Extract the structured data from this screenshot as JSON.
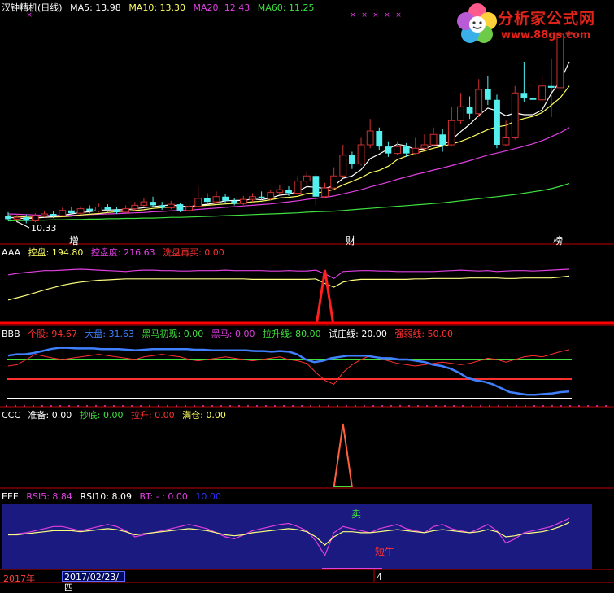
{
  "colors": {
    "bg": "#000000",
    "up": "#d03030",
    "down": "#54f0f0",
    "ma5": "#ffffff",
    "ma10": "#ffff60",
    "ma20": "#e040e0",
    "ma60": "#40e040",
    "aaa_line1": "#e040e0",
    "aaa_line2": "#ffff80",
    "bbb_blue": "#4080ff",
    "bbb_red": "#ff3030",
    "bbb_green": "#40e040",
    "panel_blue": "#1a1a80",
    "separator": "#c00000"
  },
  "header": {
    "name": "汉钟精机(日线)",
    "ma5": "MA5: 13.98",
    "ma10": "MA10: 13.30",
    "ma20": "MA20: 12.43",
    "ma60": "MA60: 11.25"
  },
  "main_annotations": {
    "low_label": "10.33",
    "tag_zeng": "增",
    "tag_cai": "财",
    "tag_bang": "榜",
    "x_marks": [
      "×",
      "×",
      "×",
      "×",
      "×",
      "×"
    ]
  },
  "aaa": {
    "name": "AAA",
    "kongpan": "控盘: 194.80",
    "kongpandu": "控盘度: 216.63",
    "xipan": "洗盘再买: 0.00"
  },
  "bbb": {
    "name": "BBB",
    "gegu": "个股: 94.67",
    "dapan": "大盘: 31.63",
    "heima_chu": "黑马初现: 0.00",
    "heima": "黑马: 0.00",
    "lasheng": "拉升线: 80.00",
    "shizhuang": "试庄线: 20.00",
    "qiangruo": "强弱线: 50.00"
  },
  "ccc": {
    "name": "CCC",
    "zhunbei": "准备: 0.00",
    "chaodi": "抄底: 0.00",
    "lasheng": "拉升: 0.00",
    "mancang": "满仓: 0.00"
  },
  "eee": {
    "name": "EEE",
    "rsi5": "RSI5: 8.84",
    "rsi10": "RSI10: 8.09",
    "bt": "BT: - : 0.00",
    "extra": "10.00",
    "sell": "卖",
    "short_bull": "短牛"
  },
  "footer": {
    "year": "2017年",
    "date": "2017/02/23/四",
    "num": "4"
  },
  "logo": {
    "title": "分析家公式网",
    "url": "www.88gs.com"
  },
  "chart_data": {
    "type": "candlestick",
    "title": "汉钟精机(日线)",
    "candles": [
      [
        10.55,
        10.45,
        10.65,
        10.4
      ],
      [
        10.45,
        10.5,
        10.6,
        10.35
      ],
      [
        10.5,
        10.4,
        10.58,
        10.33
      ],
      [
        10.4,
        10.55,
        10.62,
        10.36
      ],
      [
        10.55,
        10.6,
        10.7,
        10.5
      ],
      [
        10.6,
        10.55,
        10.68,
        10.48
      ],
      [
        10.55,
        10.7,
        10.78,
        10.52
      ],
      [
        10.7,
        10.62,
        10.8,
        10.58
      ],
      [
        10.62,
        10.75,
        10.82,
        10.58
      ],
      [
        10.75,
        10.68,
        10.85,
        10.62
      ],
      [
        10.68,
        10.8,
        10.9,
        10.64
      ],
      [
        10.8,
        10.72,
        10.88,
        10.66
      ],
      [
        10.72,
        10.65,
        10.8,
        10.6
      ],
      [
        10.65,
        10.75,
        10.85,
        10.6
      ],
      [
        10.75,
        10.85,
        10.95,
        10.7
      ],
      [
        10.85,
        10.95,
        11.05,
        10.8
      ],
      [
        10.95,
        10.85,
        11.1,
        10.8
      ],
      [
        10.85,
        10.78,
        10.95,
        10.72
      ],
      [
        10.78,
        10.88,
        10.98,
        10.74
      ],
      [
        10.88,
        10.7,
        10.92,
        10.65
      ],
      [
        10.7,
        10.82,
        10.9,
        10.66
      ],
      [
        10.82,
        11.05,
        11.4,
        10.8
      ],
      [
        11.05,
        10.95,
        11.2,
        10.9
      ],
      [
        10.95,
        11.1,
        11.25,
        10.9
      ],
      [
        11.1,
        10.98,
        11.18,
        10.9
      ],
      [
        10.98,
        10.9,
        11.05,
        10.85
      ],
      [
        10.9,
        11.02,
        11.12,
        10.86
      ],
      [
        11.02,
        11.1,
        11.2,
        10.95
      ],
      [
        11.1,
        11.05,
        11.25,
        11.0
      ],
      [
        11.05,
        11.22,
        11.3,
        11.0
      ],
      [
        11.22,
        11.3,
        11.45,
        11.15
      ],
      [
        11.3,
        11.2,
        11.4,
        11.12
      ],
      [
        11.2,
        11.55,
        11.7,
        11.15
      ],
      [
        11.55,
        11.7,
        11.85,
        11.45
      ],
      [
        11.7,
        11.1,
        11.75,
        10.85
      ],
      [
        11.1,
        11.35,
        11.5,
        11.05
      ],
      [
        11.35,
        11.7,
        11.95,
        11.3
      ],
      [
        11.7,
        12.3,
        12.6,
        11.65
      ],
      [
        12.3,
        12.05,
        12.4,
        11.9
      ],
      [
        12.05,
        12.6,
        12.8,
        12.0
      ],
      [
        12.6,
        13.0,
        13.35,
        12.5
      ],
      [
        13.0,
        12.55,
        13.1,
        12.45
      ],
      [
        12.55,
        12.35,
        12.7,
        12.25
      ],
      [
        12.35,
        12.55,
        12.7,
        12.3
      ],
      [
        12.55,
        12.35,
        12.65,
        12.25
      ],
      [
        12.35,
        12.5,
        12.8,
        12.3
      ],
      [
        12.5,
        12.6,
        12.9,
        12.45
      ],
      [
        12.6,
        12.9,
        13.1,
        12.55
      ],
      [
        12.9,
        12.6,
        13.05,
        12.4
      ],
      [
        12.6,
        13.3,
        13.7,
        12.55
      ],
      [
        13.3,
        13.7,
        14.1,
        13.2
      ],
      [
        13.7,
        13.5,
        14.0,
        13.35
      ],
      [
        13.5,
        14.2,
        14.5,
        13.4
      ],
      [
        14.2,
        13.9,
        14.6,
        13.75
      ],
      [
        13.9,
        12.6,
        14.05,
        12.5
      ],
      [
        12.6,
        12.8,
        13.3,
        12.55
      ],
      [
        12.8,
        14.1,
        14.3,
        12.75
      ],
      [
        14.1,
        13.95,
        15.0,
        13.85
      ],
      [
        13.95,
        13.9,
        14.15,
        13.8
      ],
      [
        13.9,
        14.3,
        14.6,
        13.85
      ],
      [
        14.3,
        14.25,
        15.1,
        13.4
      ],
      [
        14.25,
        15.8,
        15.8,
        15.7
      ],
      [
        15.8,
        15.85,
        15.9,
        15.75
      ]
    ],
    "ma5": [
      10.5,
      10.48,
      10.47,
      10.48,
      10.5,
      10.52,
      10.56,
      10.6,
      10.64,
      10.66,
      10.71,
      10.71,
      10.72,
      10.72,
      10.75,
      10.78,
      10.81,
      10.84,
      10.86,
      10.83,
      10.81,
      10.85,
      10.88,
      10.92,
      10.98,
      10.99,
      10.99,
      11.03,
      11.01,
      11.06,
      11.14,
      11.17,
      11.25,
      11.39,
      11.37,
      11.34,
      11.41,
      11.63,
      11.7,
      11.88,
      12.2,
      12.33,
      12.48,
      12.62,
      12.57,
      12.46,
      12.48,
      12.59,
      12.59,
      12.74,
      12.98,
      13.19,
      13.45,
      13.66,
      13.58,
      13.44,
      13.52,
      13.47,
      13.47,
      13.61,
      14.08,
      14.44,
      15.0
    ],
    "ma10": [
      10.55,
      10.53,
      10.51,
      10.5,
      10.5,
      10.51,
      10.52,
      10.54,
      10.57,
      10.59,
      10.61,
      10.64,
      10.66,
      10.68,
      10.7,
      10.72,
      10.76,
      10.78,
      10.8,
      10.8,
      10.81,
      10.83,
      10.85,
      10.87,
      10.89,
      10.9,
      10.92,
      10.95,
      10.97,
      11.01,
      11.06,
      11.08,
      11.11,
      11.19,
      11.21,
      11.24,
      11.31,
      11.44,
      11.54,
      11.65,
      11.79,
      11.86,
      11.98,
      12.17,
      12.27,
      12.36,
      12.42,
      12.5,
      12.56,
      12.62,
      12.7,
      12.8,
      12.92,
      13.04,
      13.12,
      13.16,
      13.28,
      13.36,
      13.42,
      13.53,
      13.74,
      13.96,
      14.3
    ],
    "ma20": [
      10.6,
      10.59,
      10.58,
      10.57,
      10.56,
      10.56,
      10.56,
      10.56,
      10.57,
      10.58,
      10.59,
      10.6,
      10.61,
      10.62,
      10.63,
      10.64,
      10.66,
      10.67,
      10.69,
      10.7,
      10.71,
      10.73,
      10.75,
      10.77,
      10.79,
      10.81,
      10.83,
      10.85,
      10.87,
      10.89,
      10.92,
      10.95,
      10.98,
      11.02,
      11.05,
      11.08,
      11.12,
      11.18,
      11.24,
      11.3,
      11.38,
      11.45,
      11.52,
      11.6,
      11.67,
      11.74,
      11.8,
      11.87,
      11.93,
      12.0,
      12.07,
      12.14,
      12.22,
      12.3,
      12.36,
      12.42,
      12.49,
      12.56,
      12.63,
      12.72,
      12.83,
      12.95,
      13.1
    ],
    "ma60": [
      10.4,
      10.41,
      10.41,
      10.42,
      10.42,
      10.43,
      10.43,
      10.44,
      10.44,
      10.45,
      10.45,
      10.46,
      10.46,
      10.47,
      10.47,
      10.48,
      10.48,
      10.49,
      10.5,
      10.5,
      10.51,
      10.52,
      10.53,
      10.54,
      10.55,
      10.56,
      10.57,
      10.58,
      10.59,
      10.6,
      10.61,
      10.62,
      10.63,
      10.65,
      10.66,
      10.67,
      10.68,
      10.7,
      10.72,
      10.74,
      10.76,
      10.78,
      10.8,
      10.82,
      10.84,
      10.86,
      10.88,
      10.9,
      10.92,
      10.95,
      10.98,
      11.01,
      11.04,
      11.07,
      11.1,
      11.13,
      11.16,
      11.2,
      11.24,
      11.28,
      11.33,
      11.4,
      11.48
    ],
    "aaa_kongpandu": [
      205,
      208,
      210,
      212,
      214,
      214,
      215,
      216,
      217,
      216,
      215,
      214,
      213,
      212,
      214,
      215,
      215,
      214,
      214,
      213,
      213,
      214,
      214,
      214,
      215,
      214,
      214,
      214,
      214,
      213,
      213,
      214,
      213,
      213,
      215,
      207,
      197,
      212,
      213,
      214,
      214,
      213,
      213,
      212,
      212,
      212,
      212,
      212,
      213,
      214,
      215,
      214,
      213,
      214,
      212,
      213,
      214,
      214,
      213,
      214,
      215,
      216,
      217
    ],
    "aaa_kongpan": [
      150,
      155,
      160,
      166,
      172,
      177,
      182,
      186,
      189,
      191,
      193,
      194,
      195,
      196,
      196,
      196,
      196,
      196,
      196,
      196,
      196,
      196,
      196,
      196,
      196,
      196,
      196,
      195,
      195,
      195,
      195,
      195,
      195,
      195,
      196,
      186,
      178,
      189,
      193,
      195,
      195,
      195,
      195,
      195,
      195,
      196,
      196,
      197,
      197,
      197,
      197,
      198,
      198,
      198,
      198,
      197,
      197,
      198,
      198,
      198,
      198,
      200,
      202
    ],
    "aaa_spike_index": 35,
    "bbb_gegu": [
      70,
      72,
      80,
      88,
      85,
      82,
      80,
      82,
      84,
      86,
      88,
      86,
      84,
      82,
      80,
      84,
      86,
      88,
      86,
      84,
      80,
      78,
      80,
      82,
      84,
      82,
      80,
      78,
      80,
      82,
      84,
      80,
      78,
      74,
      60,
      48,
      42,
      60,
      72,
      80,
      86,
      82,
      78,
      74,
      72,
      70,
      72,
      74,
      76,
      74,
      72,
      74,
      78,
      82,
      80,
      76,
      80,
      84,
      86,
      84,
      88,
      92,
      95
    ],
    "bbb_dapan": [
      86,
      88,
      88,
      90,
      93,
      96,
      98,
      98,
      97,
      97,
      97,
      96,
      96,
      96,
      95,
      94,
      95,
      96,
      96,
      96,
      96,
      96,
      95,
      95,
      94,
      94,
      94,
      94,
      94,
      93,
      93,
      92,
      93,
      92,
      88,
      80,
      76,
      78,
      82,
      84,
      86,
      86,
      86,
      84,
      82,
      82,
      80,
      80,
      78,
      76,
      72,
      70,
      66,
      60,
      52,
      48,
      46,
      42,
      36,
      30,
      28,
      26,
      26,
      27,
      28,
      30,
      31
    ],
    "bbb_levels": {
      "lasheng": 80,
      "qiangruo": 50,
      "shizhuang": 20
    },
    "ccc_spike_index": 37,
    "eee_rsi5": [
      52,
      53,
      54,
      56,
      58,
      60,
      60,
      58,
      56,
      58,
      60,
      62,
      60,
      56,
      50,
      52,
      54,
      56,
      58,
      60,
      62,
      60,
      58,
      54,
      50,
      48,
      52,
      56,
      58,
      60,
      62,
      63,
      60,
      56,
      46,
      32,
      54,
      60,
      58,
      56,
      54,
      58,
      60,
      62,
      58,
      56,
      54,
      60,
      62,
      58,
      56,
      54,
      58,
      62,
      56,
      44,
      48,
      54,
      56,
      58,
      60,
      64,
      68
    ],
    "eee_rsi10": [
      52,
      52,
      53,
      54,
      55,
      56,
      56,
      56,
      55,
      56,
      57,
      58,
      57,
      55,
      52,
      53,
      54,
      55,
      56,
      57,
      58,
      57,
      56,
      54,
      52,
      51,
      52,
      54,
      55,
      56,
      57,
      58,
      57,
      55,
      50,
      42,
      50,
      55,
      55,
      54,
      54,
      55,
      56,
      57,
      56,
      55,
      54,
      56,
      57,
      56,
      55,
      54,
      55,
      57,
      55,
      50,
      51,
      53,
      54,
      55,
      57,
      60,
      64
    ]
  }
}
